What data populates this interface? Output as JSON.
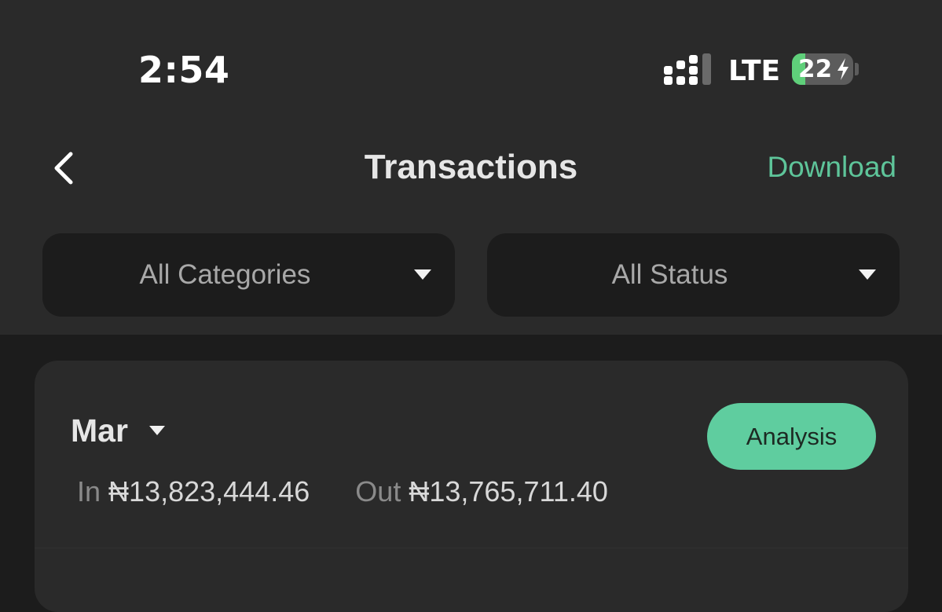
{
  "status_bar": {
    "time": "2:54",
    "network": "LTE",
    "battery_level": "22",
    "battery_fraction": 0.22,
    "battery_fill_color": "#5fcf7a",
    "signal_icon": "cellular-signal-icon",
    "charging_icon": "lightning-bolt-icon"
  },
  "nav": {
    "title": "Transactions",
    "download_label": "Download",
    "back_icon": "chevron-left-icon"
  },
  "filters": {
    "category": "All Categories",
    "status": "All Status"
  },
  "month_summary": {
    "month": "Mar",
    "in_label": "In",
    "in_amount": "₦13,823,444.46",
    "out_label": "Out",
    "out_amount": "₦13,765,711.40",
    "analysis_label": "Analysis"
  },
  "colors": {
    "accent": "#5ec59a",
    "analysis_button": "#5fcd9f",
    "header_bg": "#2a2a2a",
    "page_bg": "#1c1c1c"
  }
}
